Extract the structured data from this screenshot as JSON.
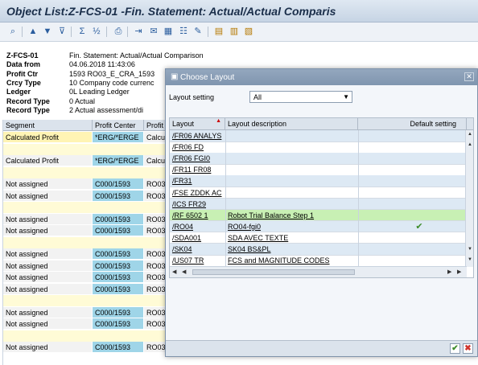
{
  "window": {
    "title": "Object List:Z-FCS-01 -Fin. Statement: Actual/Actual Comparis"
  },
  "toolbar": {
    "icons": [
      "find-icon",
      "sort-ascending-icon",
      "sort-descending-icon",
      "filter-icon",
      "sum-icon",
      "subtotal-icon",
      "print-icon",
      "export-icon",
      "mail-icon",
      "graphic-icon",
      "choose-layout-icon",
      "save-layout-icon",
      "layout-grid-icon",
      "change-layout-icon",
      "save-icon"
    ]
  },
  "header": {
    "rows": [
      {
        "key": "Z-FCS-01",
        "value": "Fin. Statement: Actual/Actual Comparison"
      },
      {
        "key": "Data from",
        "value": "04.06.2018 11:43:06"
      },
      {
        "key": "Profit Ctr",
        "value": "1593 RO03_E_CRA_1593"
      },
      {
        "key": "Crcy Type",
        "value": "10 Company code currenc"
      },
      {
        "key": "Ledger",
        "value": "0L Leading Ledger"
      },
      {
        "key": "Record Type",
        "value": "0 Actual"
      },
      {
        "key": "Record Type",
        "value": "2 Actual assessment/di"
      }
    ]
  },
  "grid": {
    "columns": [
      "Segment",
      "Profit Center",
      "Profit"
    ],
    "rows": [
      {
        "a": "Calculated Profit",
        "b": "*ERG/*ERGE",
        "c": "Calcul"
      },
      {
        "blank": true
      },
      {
        "a": "Calculated Profit",
        "b": "*ERG/*ERGE",
        "c": "Calcul"
      },
      {
        "blank": true
      },
      {
        "a": "Not assigned",
        "b": "C000/1593",
        "c": "RO03"
      },
      {
        "a": "Not assigned",
        "b": "C000/1593",
        "c": "RO03"
      },
      {
        "blank": true
      },
      {
        "a": "Not assigned",
        "b": "C000/1593",
        "c": "RO03"
      },
      {
        "a": "Not assigned",
        "b": "C000/1593",
        "c": "RO03"
      },
      {
        "blank": true
      },
      {
        "a": "Not assigned",
        "b": "C000/1593",
        "c": "RO03"
      },
      {
        "a": "Not assigned",
        "b": "C000/1593",
        "c": "RO03"
      },
      {
        "a": "Not assigned",
        "b": "C000/1593",
        "c": "RO03"
      },
      {
        "a": "Not assigned",
        "b": "C000/1593",
        "c": "RO03"
      },
      {
        "blank": true
      },
      {
        "a": "Not assigned",
        "b": "C000/1593",
        "c": "RO03"
      },
      {
        "a": "Not assigned",
        "b": "C000/1593",
        "c": "RO03"
      },
      {
        "blank": true
      },
      {
        "a": "Not assigned",
        "b": "C000/1593",
        "c": "RO03"
      }
    ]
  },
  "dialog": {
    "title": "Choose Layout",
    "layout_setting_label": "Layout setting",
    "layout_setting_value": "All",
    "columns": {
      "layout": "Layout",
      "description": "Layout description",
      "default": "Default setting"
    },
    "rows": [
      {
        "layout": "/FR06 ANALYS",
        "description": "",
        "default": false
      },
      {
        "layout": "/FR06 FD",
        "description": "",
        "default": false
      },
      {
        "layout": "/FR06 FGI0",
        "description": "",
        "default": false
      },
      {
        "layout": "/FR11 FR08",
        "description": "",
        "default": false
      },
      {
        "layout": "/FR31",
        "description": "",
        "default": false
      },
      {
        "layout": "/FSE ZDDK AC",
        "description": "",
        "default": false
      },
      {
        "layout": "/ICS FR29",
        "description": "",
        "default": false
      },
      {
        "layout": "/RF 6502 1",
        "description": "Robot Trial Balance Step 1",
        "default": false,
        "selected": true
      },
      {
        "layout": "/RO04",
        "description": "RO04-fgi0",
        "default": true
      },
      {
        "layout": "/SDA001",
        "description": "SDA AVEC TEXTE",
        "default": false
      },
      {
        "layout": "/SK04",
        "description": "SK04 BS&PL",
        "default": false
      },
      {
        "layout": "/US07 TR",
        "description": "FCS and MAGNITUDE CODES",
        "default": false
      }
    ],
    "checkmark": "✔",
    "close_glyph": "✕",
    "ok_glyph": "✔",
    "cancel_glyph": "✖"
  },
  "footer_partial": "--- ---,--- ---"
}
